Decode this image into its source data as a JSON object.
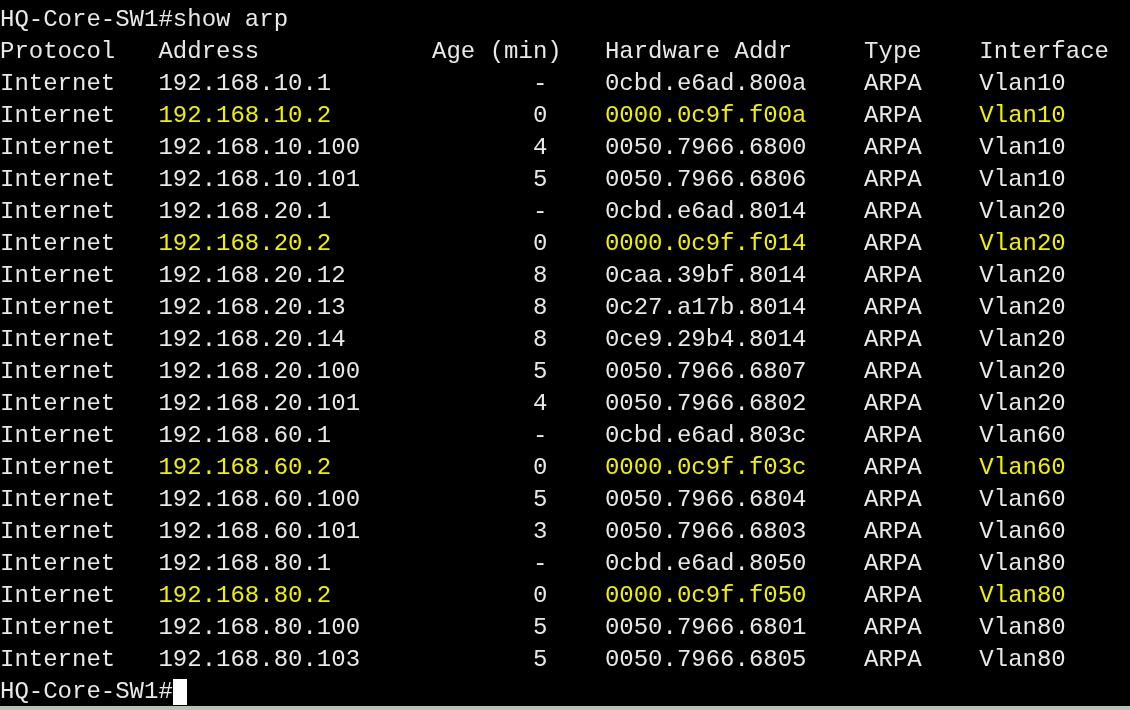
{
  "terminal": {
    "command_line": "HQ-Core-SW1#show arp",
    "columns": [
      "Protocol",
      "Address",
      "Age (min)",
      "Hardware Addr",
      "Type",
      "Interface"
    ],
    "rows": [
      {
        "protocol": "Internet",
        "address": "192.168.10.1",
        "age": "-",
        "hardware_addr": "0cbd.e6ad.800a",
        "type": "ARPA",
        "interface": "Vlan10",
        "highlighted": false
      },
      {
        "protocol": "Internet",
        "address": "192.168.10.2",
        "age": "0",
        "hardware_addr": "0000.0c9f.f00a",
        "type": "ARPA",
        "interface": "Vlan10",
        "highlighted": true
      },
      {
        "protocol": "Internet",
        "address": "192.168.10.100",
        "age": "4",
        "hardware_addr": "0050.7966.6800",
        "type": "ARPA",
        "interface": "Vlan10",
        "highlighted": false
      },
      {
        "protocol": "Internet",
        "address": "192.168.10.101",
        "age": "5",
        "hardware_addr": "0050.7966.6806",
        "type": "ARPA",
        "interface": "Vlan10",
        "highlighted": false
      },
      {
        "protocol": "Internet",
        "address": "192.168.20.1",
        "age": "-",
        "hardware_addr": "0cbd.e6ad.8014",
        "type": "ARPA",
        "interface": "Vlan20",
        "highlighted": false
      },
      {
        "protocol": "Internet",
        "address": "192.168.20.2",
        "age": "0",
        "hardware_addr": "0000.0c9f.f014",
        "type": "ARPA",
        "interface": "Vlan20",
        "highlighted": true
      },
      {
        "protocol": "Internet",
        "address": "192.168.20.12",
        "age": "8",
        "hardware_addr": "0caa.39bf.8014",
        "type": "ARPA",
        "interface": "Vlan20",
        "highlighted": false
      },
      {
        "protocol": "Internet",
        "address": "192.168.20.13",
        "age": "8",
        "hardware_addr": "0c27.a17b.8014",
        "type": "ARPA",
        "interface": "Vlan20",
        "highlighted": false
      },
      {
        "protocol": "Internet",
        "address": "192.168.20.14",
        "age": "8",
        "hardware_addr": "0ce9.29b4.8014",
        "type": "ARPA",
        "interface": "Vlan20",
        "highlighted": false
      },
      {
        "protocol": "Internet",
        "address": "192.168.20.100",
        "age": "5",
        "hardware_addr": "0050.7966.6807",
        "type": "ARPA",
        "interface": "Vlan20",
        "highlighted": false
      },
      {
        "protocol": "Internet",
        "address": "192.168.20.101",
        "age": "4",
        "hardware_addr": "0050.7966.6802",
        "type": "ARPA",
        "interface": "Vlan20",
        "highlighted": false
      },
      {
        "protocol": "Internet",
        "address": "192.168.60.1",
        "age": "-",
        "hardware_addr": "0cbd.e6ad.803c",
        "type": "ARPA",
        "interface": "Vlan60",
        "highlighted": false
      },
      {
        "protocol": "Internet",
        "address": "192.168.60.2",
        "age": "0",
        "hardware_addr": "0000.0c9f.f03c",
        "type": "ARPA",
        "interface": "Vlan60",
        "highlighted": true
      },
      {
        "protocol": "Internet",
        "address": "192.168.60.100",
        "age": "5",
        "hardware_addr": "0050.7966.6804",
        "type": "ARPA",
        "interface": "Vlan60",
        "highlighted": false
      },
      {
        "protocol": "Internet",
        "address": "192.168.60.101",
        "age": "3",
        "hardware_addr": "0050.7966.6803",
        "type": "ARPA",
        "interface": "Vlan60",
        "highlighted": false
      },
      {
        "protocol": "Internet",
        "address": "192.168.80.1",
        "age": "-",
        "hardware_addr": "0cbd.e6ad.8050",
        "type": "ARPA",
        "interface": "Vlan80",
        "highlighted": false
      },
      {
        "protocol": "Internet",
        "address": "192.168.80.2",
        "age": "0",
        "hardware_addr": "0000.0c9f.f050",
        "type": "ARPA",
        "interface": "Vlan80",
        "highlighted": true
      },
      {
        "protocol": "Internet",
        "address": "192.168.80.100",
        "age": "5",
        "hardware_addr": "0050.7966.6801",
        "type": "ARPA",
        "interface": "Vlan80",
        "highlighted": false
      },
      {
        "protocol": "Internet",
        "address": "192.168.80.103",
        "age": "5",
        "hardware_addr": "0050.7966.6805",
        "type": "ARPA",
        "interface": "Vlan80",
        "highlighted": false
      }
    ],
    "prompt": "HQ-Core-SW1#"
  }
}
